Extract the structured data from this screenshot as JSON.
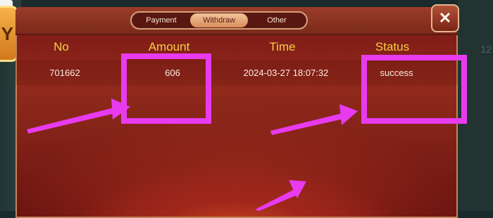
{
  "tabs": [
    {
      "label": "Payment"
    },
    {
      "label": "Withdraw",
      "active": true
    },
    {
      "label": "Other"
    }
  ],
  "close_icon": "close-icon",
  "table": {
    "headers": {
      "no": "No",
      "amount": "Amount",
      "time": "Time",
      "status": "Status"
    },
    "rows": [
      {
        "no": "701662",
        "amount": "606",
        "time": "2024-03-27 18:07:32",
        "status": "success"
      }
    ]
  },
  "side": {
    "left_badge": "Y",
    "right_number": "12"
  },
  "colors": {
    "header_text": "#f6cf45",
    "highlight": "#e83bf0",
    "active_tab": "#f3c59a"
  }
}
